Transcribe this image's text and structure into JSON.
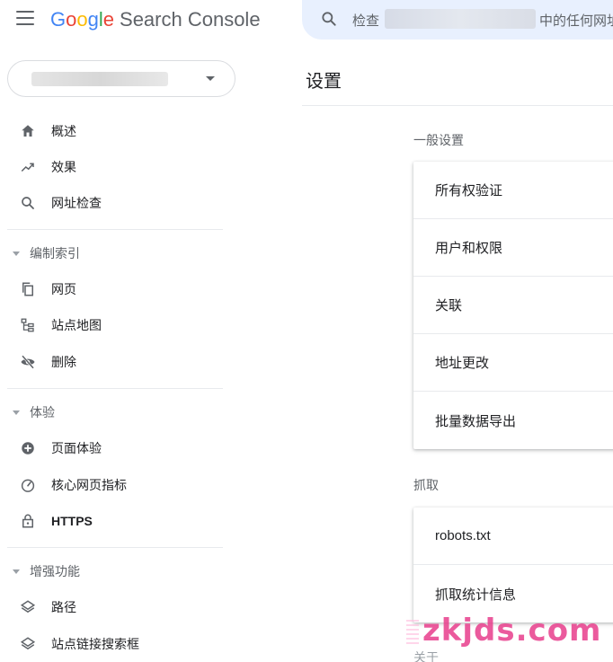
{
  "header": {
    "logo_google": [
      "G",
      "o",
      "o",
      "g",
      "l",
      "e"
    ],
    "product": "Search Console",
    "search_prefix": "检查",
    "search_suffix": "中的任何网址"
  },
  "sidebar": {
    "top_items": [
      {
        "label": "概述",
        "icon": "home-icon"
      },
      {
        "label": "效果",
        "icon": "trending-up-icon"
      },
      {
        "label": "网址检查",
        "icon": "search-icon"
      }
    ],
    "sections": [
      {
        "title": "编制索引",
        "items": [
          {
            "label": "网页",
            "icon": "pages-icon"
          },
          {
            "label": "站点地图",
            "icon": "sitemap-icon"
          },
          {
            "label": "删除",
            "icon": "eye-off-icon"
          }
        ]
      },
      {
        "title": "体验",
        "items": [
          {
            "label": "页面体验",
            "icon": "plus-circle-icon"
          },
          {
            "label": "核心网页指标",
            "icon": "speedometer-icon"
          },
          {
            "label": "HTTPS",
            "icon": "lock-icon"
          }
        ]
      },
      {
        "title": "增强功能",
        "items": [
          {
            "label": "路径",
            "icon": "layers-icon"
          },
          {
            "label": "站点链接搜索框",
            "icon": "layers-icon"
          }
        ]
      }
    ]
  },
  "main": {
    "title": "设置",
    "groups": [
      {
        "title": "一般设置",
        "rows": [
          "所有权验证",
          "用户和权限",
          "关联",
          "地址更改",
          "批量数据导出"
        ]
      },
      {
        "title": "抓取",
        "rows": [
          "robots.txt",
          "抓取统计信息"
        ]
      }
    ],
    "partial_next_title": "关于"
  },
  "watermark": "zkjds.com",
  "colors": {
    "accent": "#1a73e8",
    "search_bg": "#e8f0fe",
    "icon": "#5f6368"
  }
}
